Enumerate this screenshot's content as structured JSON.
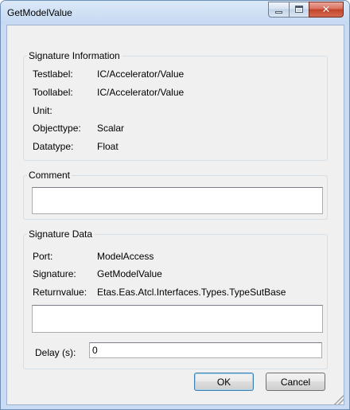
{
  "window": {
    "title": "GetModelValue",
    "minimize_icon": "minimize-icon",
    "maximize_icon": "maximize-icon",
    "close_icon": "close-icon",
    "close_glyph": "✕"
  },
  "signature_info": {
    "legend": "Signature Information",
    "rows": [
      {
        "label": "Testlabel:",
        "value": "IC/Accelerator/Value"
      },
      {
        "label": "Toollabel:",
        "value": "IC/Accelerator/Value"
      },
      {
        "label": "Unit:",
        "value": ""
      },
      {
        "label": "Objecttype:",
        "value": "Scalar"
      },
      {
        "label": "Datatype:",
        "value": "Float"
      }
    ]
  },
  "comment": {
    "legend": "Comment",
    "value": ""
  },
  "signature_data": {
    "legend": "Signature Data",
    "rows": [
      {
        "label": "Port:",
        "value": "ModelAccess"
      },
      {
        "label": "Signature:",
        "value": "GetModelValue"
      },
      {
        "label": "Returnvalue:",
        "value": "Etas.Eas.Atcl.Interfaces.Types.TypeSutBase"
      }
    ],
    "return_box_value": "",
    "delay_label": "Delay (s):",
    "delay_value": "0"
  },
  "buttons": {
    "ok": "OK",
    "cancel": "Cancel"
  }
}
